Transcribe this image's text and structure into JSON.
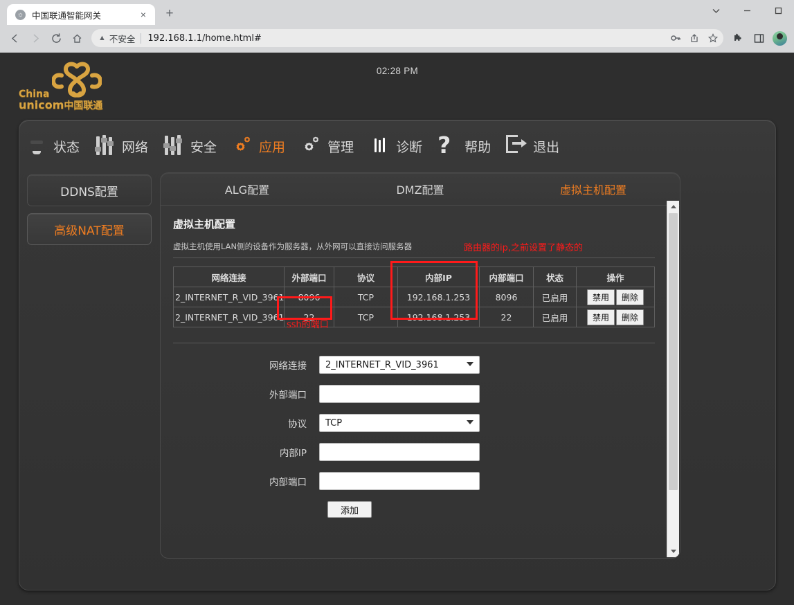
{
  "browser": {
    "tab": {
      "title": "中国联通智能网关",
      "favicon": "globe-icon",
      "close": "×"
    },
    "newtab_label": "+",
    "window_controls": {
      "chevron": "chevron-down-icon",
      "minimize": "minimize-icon",
      "maximize": "maximize-icon"
    },
    "nav": {
      "back": "←",
      "forward": "→",
      "reload": "C",
      "home": "⌂"
    },
    "omnibox": {
      "security_label": "不安全",
      "warning_icon": "warning-triangle-icon",
      "url": "192.168.1.1/home.html#",
      "actions": [
        "key-icon",
        "share-icon",
        "bookmark-star-icon"
      ]
    },
    "toolbar_right": [
      "extensions-puzzle-icon",
      "side-panel-icon",
      "profile-avatar"
    ]
  },
  "router": {
    "logo": {
      "line1": "China",
      "line2": "unicom",
      "cn": "中国联通",
      "symbol": "unicom-knot-icon",
      "color": "#d9a441"
    },
    "clock": "02:28 PM",
    "accent_color": "#ef7d21",
    "annotation_color": "#ff1a1a",
    "nav": [
      {
        "label": "状态",
        "icon": "monitor-icon",
        "active": false
      },
      {
        "label": "网络",
        "icon": "sliders-icon",
        "active": false
      },
      {
        "label": "安全",
        "icon": "sliders-icon",
        "active": false
      },
      {
        "label": "应用",
        "icon": "gears-icon",
        "active": true
      },
      {
        "label": "管理",
        "icon": "gears-icon",
        "active": false
      },
      {
        "label": "诊断",
        "icon": "diagnostics-icon",
        "active": false
      },
      {
        "label": "帮助",
        "icon": "question-mark-icon",
        "active": false
      },
      {
        "label": "退出",
        "icon": "exit-icon",
        "active": false
      }
    ],
    "sidebar": [
      {
        "label": "DDNS配置",
        "active": false
      },
      {
        "label": "高级NAT配置",
        "active": true
      }
    ],
    "tabs": [
      {
        "label": "ALG配置",
        "active": false
      },
      {
        "label": "DMZ配置",
        "active": false
      },
      {
        "label": "虚拟主机配置",
        "active": true
      }
    ],
    "section": {
      "title": "虚拟主机配置",
      "description": "虚拟主机使用LAN侧的设备作为服务器，从外网可以直接访问服务器"
    },
    "annotations": {
      "ip_note": "路由器的ip,之前设置了静态的",
      "port_note": "ssh的端口"
    },
    "table": {
      "headers": [
        "网络连接",
        "外部端口",
        "协议",
        "内部IP",
        "内部端口",
        "状态",
        "操作"
      ],
      "rows": [
        {
          "connection": "2_INTERNET_R_VID_3961",
          "ext_port": "8096",
          "protocol": "TCP",
          "int_ip": "192.168.1.253",
          "int_port": "8096",
          "status": "已启用",
          "actions": [
            "禁用",
            "删除"
          ]
        },
        {
          "connection": "2_INTERNET_R_VID_3961",
          "ext_port": "22",
          "protocol": "TCP",
          "int_ip": "192.168.1.253",
          "int_port": "22",
          "status": "已启用",
          "actions": [
            "禁用",
            "删除"
          ]
        }
      ]
    },
    "form": {
      "fields": [
        {
          "label": "网络连接",
          "type": "select",
          "value": "2_INTERNET_R_VID_3961"
        },
        {
          "label": "外部端口",
          "type": "text",
          "value": "",
          "placeholder": ""
        },
        {
          "label": "协议",
          "type": "select",
          "value": "TCP"
        },
        {
          "label": "内部IP",
          "type": "text",
          "value": "",
          "placeholder": ""
        },
        {
          "label": "内部端口",
          "type": "text",
          "value": "",
          "placeholder": ""
        }
      ],
      "submit_label": "添加"
    }
  }
}
